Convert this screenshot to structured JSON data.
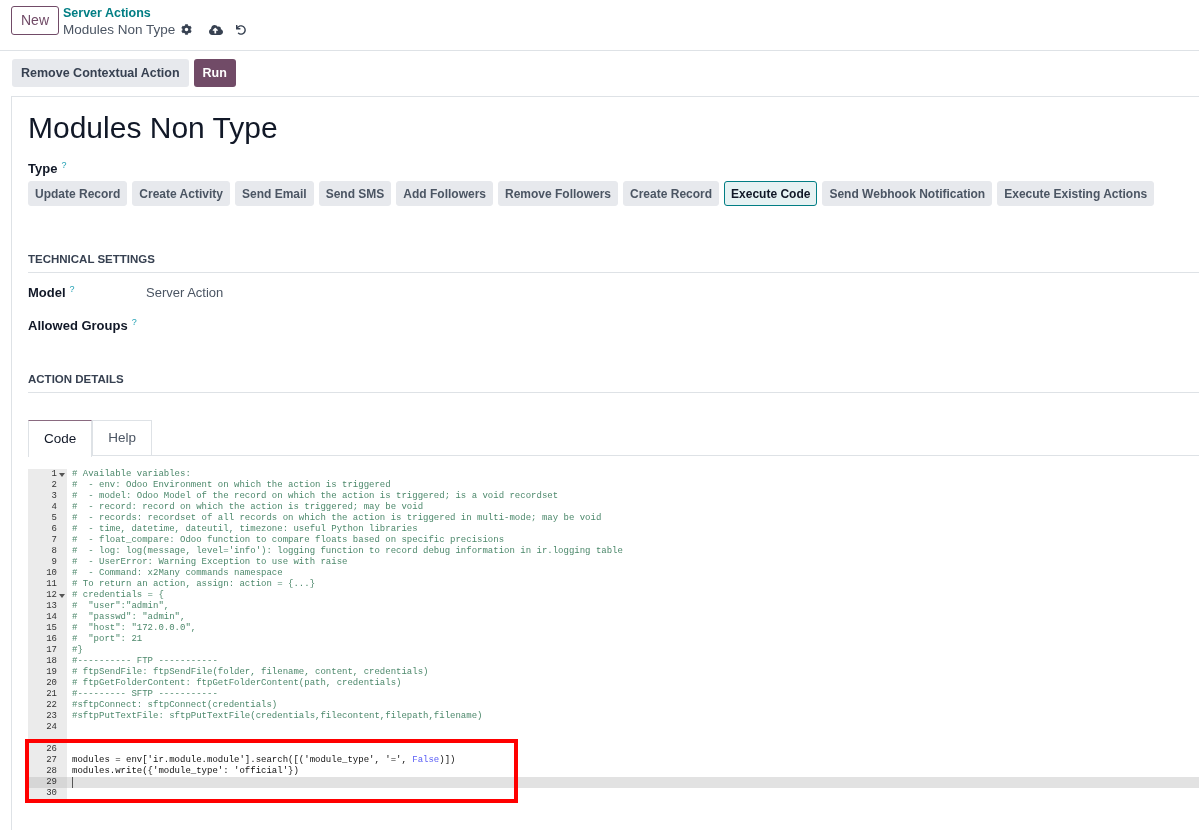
{
  "control_panel": {
    "new_button": "New",
    "breadcrumb": {
      "parent": "Server Actions",
      "current": "Modules Non Type"
    }
  },
  "action_buttons": [
    {
      "label": "Remove Contextual Action",
      "kind": "secondary"
    },
    {
      "label": "Run",
      "kind": "primary"
    }
  ],
  "form": {
    "title": "Modules Non Type",
    "type_field": {
      "label": "Type",
      "help": "?",
      "options": [
        {
          "label": "Update Record",
          "selected": false
        },
        {
          "label": "Create Activity",
          "selected": false
        },
        {
          "label": "Send Email",
          "selected": false
        },
        {
          "label": "Send SMS",
          "selected": false
        },
        {
          "label": "Add Followers",
          "selected": false
        },
        {
          "label": "Remove Followers",
          "selected": false
        },
        {
          "label": "Create Record",
          "selected": false
        },
        {
          "label": "Execute Code",
          "selected": true
        },
        {
          "label": "Send Webhook Notification",
          "selected": false
        },
        {
          "label": "Execute Existing Actions",
          "selected": false
        }
      ]
    },
    "technical_settings": {
      "title": "TECHNICAL SETTINGS",
      "fields": [
        {
          "label": "Model",
          "help": "?",
          "value": "Server Action"
        },
        {
          "label": "Allowed Groups",
          "help": "?"
        }
      ]
    },
    "action_details": {
      "title": "ACTION DETAILS"
    },
    "tabs": [
      {
        "label": "Code",
        "selected": true
      },
      {
        "label": "Help",
        "selected": false
      }
    ],
    "code_editor": {
      "lines": [
        {
          "number": "1",
          "fold": true,
          "active": false,
          "tokens": [
            {
              "kind": "comment",
              "text": "# Available variables:"
            }
          ]
        },
        {
          "number": "2",
          "active": false,
          "tokens": [
            {
              "kind": "comment",
              "text": "#  - env: Odoo Environment on which the action is triggered"
            }
          ]
        },
        {
          "number": "3",
          "active": false,
          "tokens": [
            {
              "kind": "comment",
              "text": "#  - model: Odoo Model of the record on which the action is triggered; is a void recordset"
            }
          ]
        },
        {
          "number": "4",
          "active": false,
          "tokens": [
            {
              "kind": "comment",
              "text": "#  - record: record on which the action is triggered; may be void"
            }
          ]
        },
        {
          "number": "5",
          "active": false,
          "tokens": [
            {
              "kind": "comment",
              "text": "#  - records: recordset of all records on which the action is triggered in multi-mode; may be void"
            }
          ]
        },
        {
          "number": "6",
          "active": false,
          "tokens": [
            {
              "kind": "comment",
              "text": "#  - time, datetime, dateutil, timezone: useful Python libraries"
            }
          ]
        },
        {
          "number": "7",
          "active": false,
          "tokens": [
            {
              "kind": "comment",
              "text": "#  - float_compare: Odoo function to compare floats based on specific precisions"
            }
          ]
        },
        {
          "number": "8",
          "active": false,
          "tokens": [
            {
              "kind": "comment",
              "text": "#  - log: log(message, level='info'): logging function to record debug information in ir.logging table"
            }
          ]
        },
        {
          "number": "9",
          "active": false,
          "tokens": [
            {
              "kind": "comment",
              "text": "#  - UserError: Warning Exception to use with raise"
            }
          ]
        },
        {
          "number": "10",
          "active": false,
          "tokens": [
            {
              "kind": "comment",
              "text": "#  - Command: x2Many commands namespace"
            }
          ]
        },
        {
          "number": "11",
          "active": false,
          "tokens": [
            {
              "kind": "comment",
              "text": "# To return an action, assign: action = {...}"
            }
          ]
        },
        {
          "number": "12",
          "fold": true,
          "active": false,
          "tokens": [
            {
              "kind": "comment",
              "text": "# credentials = {"
            }
          ]
        },
        {
          "number": "13",
          "active": false,
          "tokens": [
            {
              "kind": "comment",
              "text": "#  \"user\":\"admin\","
            }
          ]
        },
        {
          "number": "14",
          "active": false,
          "tokens": [
            {
              "kind": "comment",
              "text": "#  \"passwd\": \"admin\","
            }
          ]
        },
        {
          "number": "15",
          "active": false,
          "tokens": [
            {
              "kind": "comment",
              "text": "#  \"host\": \"172.0.0.0\","
            }
          ]
        },
        {
          "number": "16",
          "active": false,
          "tokens": [
            {
              "kind": "comment",
              "text": "#  \"port\": 21"
            }
          ]
        },
        {
          "number": "17",
          "active": false,
          "tokens": [
            {
              "kind": "comment",
              "text": "#}"
            }
          ]
        },
        {
          "number": "18",
          "active": false,
          "tokens": [
            {
              "kind": "comment",
              "text": "#---------- FTP -----------"
            }
          ]
        },
        {
          "number": "19",
          "active": false,
          "tokens": [
            {
              "kind": "comment",
              "text": "# ftpSendFile: ftpSendFile(folder, filename, content, credentials)"
            }
          ]
        },
        {
          "number": "20",
          "active": false,
          "tokens": [
            {
              "kind": "comment",
              "text": "# ftpGetFolderContent: ftpGetFolderContent(path, credentials)"
            }
          ]
        },
        {
          "number": "21",
          "active": false,
          "tokens": [
            {
              "kind": "comment",
              "text": "#--------- SFTP -----------"
            }
          ]
        },
        {
          "number": "22",
          "active": false,
          "tokens": [
            {
              "kind": "comment",
              "text": "#sftpConnect: sftpConnect(credentials)"
            }
          ]
        },
        {
          "number": "23",
          "active": false,
          "tokens": [
            {
              "kind": "comment",
              "text": "#sftpPutTextFile: sftpPutTextFile(credentials,filecontent,filepath,filename)"
            }
          ]
        },
        {
          "number": "24",
          "active": false
        },
        {
          "active": false
        },
        {
          "number": "26",
          "active": false
        },
        {
          "number": "27",
          "active": false,
          "tokens": [
            {
              "kind": "plain",
              "text": "modules = env['ir.module.module'].search([('module_type', '=', "
            },
            {
              "kind": "constant",
              "text": "False"
            },
            {
              "kind": "plain",
              "text": ")])"
            }
          ]
        },
        {
          "number": "28",
          "active": false,
          "tokens": [
            {
              "kind": "plain",
              "text": "modules.write({'module_type': 'official'})"
            }
          ]
        },
        {
          "number": "29",
          "active": true
        },
        {
          "number": "30",
          "active": false
        }
      ]
    }
  }
}
